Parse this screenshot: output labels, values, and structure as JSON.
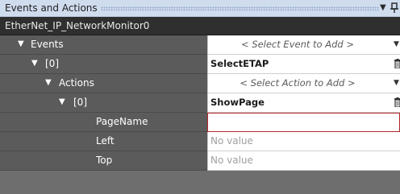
{
  "panel": {
    "title": "Events and Actions",
    "object_name": "EtherNet_IP_NetworkMonitor0",
    "dropdown_glyph": "▼",
    "pin_icon": "pin-icon"
  },
  "rows": [
    {
      "label": "Events",
      "value": "< Select Event to Add >",
      "glyph": "▼"
    },
    {
      "label": "[0]",
      "value": "SelectETAP",
      "glyph": "▼"
    },
    {
      "label": "Actions",
      "value": "< Select Action to Add >",
      "glyph": "▼"
    },
    {
      "label": "[0]",
      "value": "ShowPage",
      "glyph": "▼"
    },
    {
      "label": "PageName",
      "value": ""
    },
    {
      "label": "Left",
      "value": "No value"
    },
    {
      "label": "Top",
      "value": "No value"
    }
  ],
  "colors": {
    "titlebar_bg": "#cfdcee",
    "header_bg": "#2f2f2f",
    "label_bg": "#5b5b5b",
    "invalid_border": "#b3262b"
  }
}
